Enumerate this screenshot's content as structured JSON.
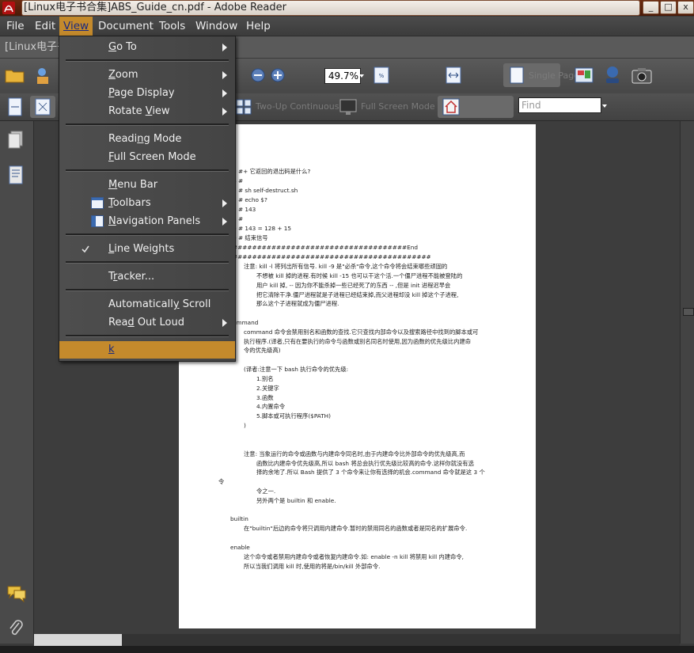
{
  "window": {
    "title": "[Linux电子书合集]ABS_Guide_cn.pdf - Adobe Reader",
    "min_label": "_",
    "max_label": "□",
    "close_label": "x"
  },
  "menubar": {
    "items": [
      "File",
      "Edit",
      "View",
      "Document",
      "Tools",
      "Window",
      "Help"
    ],
    "active": "View"
  },
  "tab": {
    "label": "[Linux电子书合集"
  },
  "toolbar": {
    "zoom_value": "49.7%",
    "find_placeholder": "Find",
    "two_up_continuous": "Two-Up Continuous",
    "full_screen_mode": "Full Screen Mode",
    "single_page": "Single Page"
  },
  "view_menu": {
    "items": [
      {
        "label": "Go To",
        "u": "G",
        "submenu": true
      },
      {
        "label": "Zoom",
        "u": "Z",
        "submenu": true
      },
      {
        "label": "Page Display",
        "u": "P",
        "submenu": true
      },
      {
        "label": "Rotate View",
        "u": "V",
        "submenu": true
      },
      {
        "label": "Reading Mode",
        "u": "n",
        "submenu": false
      },
      {
        "label": "Full Screen Mode",
        "u": "F",
        "submenu": false
      },
      {
        "label": "Menu Bar",
        "u": "M",
        "submenu": false
      },
      {
        "label": "Toolbars",
        "u": "T",
        "submenu": true
      },
      {
        "label": "Navigation Panels",
        "u": "N",
        "submenu": true
      },
      {
        "label": "Line Weights",
        "u": "L",
        "submenu": false,
        "checked": true
      },
      {
        "label": "Tracker...",
        "u": "r",
        "submenu": false
      },
      {
        "label": "Automatically Scroll",
        "u": "y",
        "submenu": false
      },
      {
        "label": "Read Out Loud",
        "u": "d",
        "submenu": true
      },
      {
        "label": "k",
        "u": "k",
        "submenu": false,
        "highlighted": true
      }
    ]
  },
  "document_lines": [
    "3 #+  它返回的退出码是什么?",
    "4 #",
    "5 # sh self-destruct.sh",
    "5 # echo $?",
    "7 # 143",
    "3 #",
    "9 # 143 = 128 + 15",
    "0 #                    结束信号",
    "####################################End",
    "#########################################",
    "注意:  kill -l 将列出所有信号. kill -9 是\"必杀\"命令,这个命令将会结束哪些顽固的",
    "不想被 kill 掉的进程.有时候 kill -15 也可以干这个活.一个僵尸进程不能被登陆的",
    "用户 kill 掉, -- 因为你不能杀掉一些已经死了的东西 -- ,但是 init 进程迟早会",
    "把它清除干净.僵尸进程就是子进程已经结束掉,而父进程却没 kill 掉这个子进程,",
    "那么这个子进程就成为僵尸进程.",
    "ommand",
    "command 命令会禁用别名和函数的查找.它只查找内部命令以及搜索路径中找到的脚本或可",
    "执行程序.(译者,只有在要执行的命令与函数或别名同名时使用,因为函数的优先级比内建命",
    "令的优先级高)",
    "(译者:注意一下 bash 执行命令的优先级:",
    "1.别名",
    "2.关键字",
    "3.函数",
    "4.内置命令",
    "5.脚本或可执行程序($PATH)",
    ")",
    "注意:  当象运行的命令或函数与内建命令同名时,由于内建命令比外部命令的优先级高,而",
    "函数比内建命令优先级高,所以 bash 将总会执行优先级比较高的命令.这样你就没有选",
    "择的余地了.所以 Bash 提供了 3 个命令来让你有选择的机会.command 命令就是这 3 个",
    "令",
    "令之一.",
    "另外两个是 builtin 和 enable.",
    "builtin",
    "在\"builtin\"后边的命令将只调用内建命令.暂时的禁用同名的函数或者是同名的扩展命令.",
    "enable",
    "这个命令或者禁用内建命令或者恢复内建命令.如: enable -n kill 将禁用 kill 内建命令,",
    "所以当我们调用 kill 时,使用的将是/bin/kill 外部命令."
  ]
}
